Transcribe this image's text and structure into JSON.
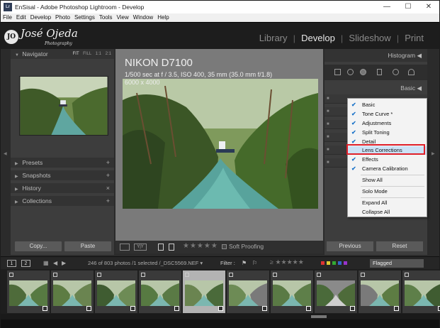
{
  "window": {
    "app_icon": "Lr",
    "title": "EnSisal - Adobe Photoshop Lightroom - Develop",
    "minimize_icon": "—",
    "maximize_icon": "☐",
    "close_icon": "✕"
  },
  "menu": [
    "File",
    "Edit",
    "Develop",
    "Photo",
    "Settings",
    "Tools",
    "View",
    "Window",
    "Help"
  ],
  "identity": {
    "logo_initial": "JO",
    "name": "José Ojeda",
    "sub": "Photography"
  },
  "modules": [
    "Library",
    "Develop",
    "Slideshow",
    "Print"
  ],
  "module_separator": "|",
  "left_panel": {
    "navigator": "Navigator",
    "nav_options": [
      "FIT",
      "FILL",
      "1:1",
      "2:1"
    ],
    "presets": "Presets",
    "snapshots": "Snapshots",
    "history": "History",
    "collections": "Collections",
    "copy_button": "Copy...",
    "paste_button": "Paste"
  },
  "photo_info": {
    "camera": "NIKON D7100",
    "exposure": "1/500 sec at f / 3.5, ISO 400, 35 mm (35.0 mm f/1.8)",
    "dimensions": "6000 x 4000"
  },
  "toolbar": {
    "stars": "★★★★★",
    "soft_proofing": "Soft Proofing",
    "view_mode": "Y|Y"
  },
  "right_panel": {
    "histogram": "Histogram",
    "basic": "Basic",
    "previous_button": "Previous",
    "reset_button": "Reset"
  },
  "context_menu": {
    "items": [
      {
        "label": "Basic",
        "checked": true
      },
      {
        "label": "Tone Curve *",
        "checked": true
      },
      {
        "label": "Adjustments",
        "checked": true
      },
      {
        "label": "Split Toning",
        "checked": true
      },
      {
        "label": "Detail",
        "checked": true
      },
      {
        "label": "Lens Corrections",
        "checked": false
      },
      {
        "label": "Effects",
        "checked": true
      },
      {
        "label": "Camera Calibration",
        "checked": true
      }
    ],
    "show_all": "Show All",
    "solo_mode": "Solo Mode",
    "expand_all": "Expand All",
    "collapse_all": "Collapse All",
    "check_glyph": "✔"
  },
  "filmstrip_header": {
    "page1": "1",
    "page2": "2",
    "info": "246 of 803 photos /1 selected /_DSC5569.NEF ▾",
    "filter_label": "Filter :",
    "stars": "≥ ★★★★★",
    "flagged": "Flagged"
  },
  "colors": {
    "accent_check": "#1a73c9",
    "highlight": "#cce2f6",
    "callout_red": "#e0202a",
    "label_red": "#d33",
    "label_yellow": "#dc3",
    "label_green": "#3a3",
    "label_blue": "#36c",
    "label_purple": "#93c"
  }
}
